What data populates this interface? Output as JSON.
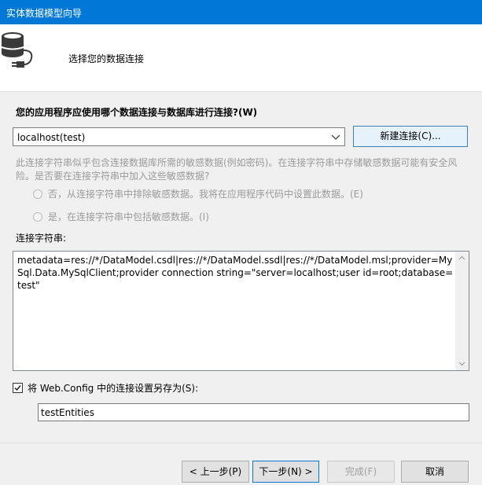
{
  "window": {
    "title": "实体数据模型向导"
  },
  "header": {
    "heading": "选择您的数据连接",
    "icon": "database-plug-icon"
  },
  "question": "您的应用程序应使用哪个数据连接与数据库进行连接?(W)",
  "connection": {
    "selected": "localhost(test)",
    "new_button": "新建连接(C)..."
  },
  "sensitive": {
    "description": "此连接字符串似乎包含连接数据库所需的敏感数据(例如密码)。在连接字符串中存储敏感数据可能有安全风险。是否要在连接字符串中加入这些敏感数据?",
    "option_exclude": "否，从连接字符串中排除敏感数据。我将在应用程序代码中设置此数据。(E)",
    "option_include": "是，在连接字符串中包括敏感数据。(I)"
  },
  "connection_string": {
    "label": "连接字符串:",
    "value": "metadata=res://*/DataModel.csdl|res://*/DataModel.ssdl|res://*/DataModel.msl;provider=MySql.Data.MySqlClient;provider connection string=\"server=localhost;user id=root;database=test\""
  },
  "save": {
    "checked": true,
    "label": "将 Web.Config 中的连接设置另存为(S):",
    "value": "testEntities"
  },
  "buttons": {
    "prev": "< 上一步(P)",
    "next": "下一步(N) >",
    "finish": "完成(F)",
    "cancel": "取消"
  }
}
